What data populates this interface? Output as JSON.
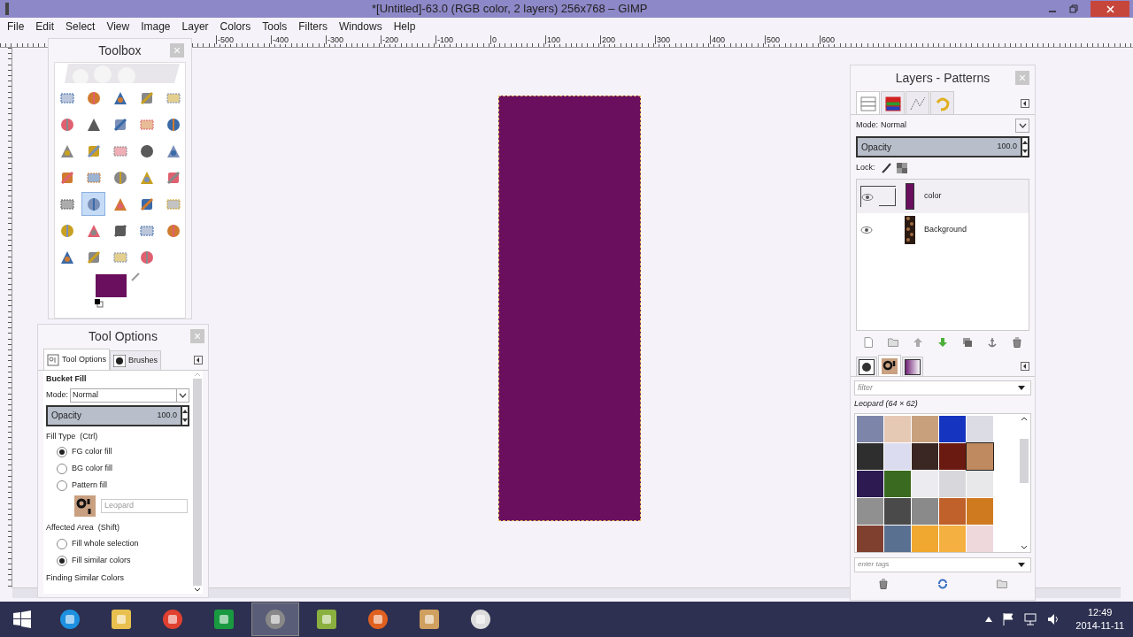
{
  "window": {
    "title": "*[Untitled]-63.0 (RGB color, 2 layers) 256x768 – GIMP"
  },
  "menu": [
    "File",
    "Edit",
    "Select",
    "View",
    "Image",
    "Layer",
    "Colors",
    "Tools",
    "Filters",
    "Windows",
    "Help"
  ],
  "ruler": {
    "labels": [
      "-500",
      "-400",
      "-300",
      "-200",
      "-100",
      "0",
      "100",
      "200",
      "300",
      "400",
      "500",
      "600"
    ]
  },
  "toolbox": {
    "title": "Toolbox",
    "tools": [
      {
        "selected": false
      },
      {
        "selected": false
      },
      {
        "selected": false
      },
      {
        "selected": false
      },
      {
        "selected": false
      },
      {
        "selected": false
      },
      {
        "selected": false
      },
      {
        "selected": false
      },
      {
        "selected": false
      },
      {
        "selected": false
      },
      {
        "selected": false
      },
      {
        "selected": false
      },
      {
        "selected": false
      },
      {
        "selected": false
      },
      {
        "selected": false
      },
      {
        "selected": false
      },
      {
        "selected": false
      },
      {
        "selected": false
      },
      {
        "selected": false
      },
      {
        "selected": false
      },
      {
        "selected": false
      },
      {
        "selected": true
      },
      {
        "selected": false
      },
      {
        "selected": false
      },
      {
        "selected": false
      },
      {
        "selected": false
      },
      {
        "selected": false
      },
      {
        "selected": false
      },
      {
        "selected": false
      },
      {
        "selected": false
      },
      {
        "selected": false
      },
      {
        "selected": false
      },
      {
        "selected": false
      },
      {
        "selected": false
      }
    ]
  },
  "tool_options": {
    "title": "Tool Options",
    "tabs": [
      {
        "label": "Tool Options",
        "selected": true
      },
      {
        "label": "Brushes",
        "selected": false
      }
    ],
    "tool_name": "Bucket Fill",
    "mode_label": "Mode:",
    "mode": "Normal",
    "opacity": {
      "label": "Opacity",
      "value": "100.0",
      "level": 1
    },
    "fill_type": {
      "label": "Fill Type  (Ctrl)",
      "options": [
        {
          "label": "FG color fill",
          "selected": true
        },
        {
          "label": "BG color fill",
          "selected": false
        },
        {
          "label": "Pattern fill",
          "selected": false
        }
      ]
    },
    "pattern_field": "Leopard",
    "affected_area": {
      "label": "Affected Area  (Shift)",
      "options": [
        {
          "label": "Fill whole selection",
          "selected": false
        },
        {
          "label": "Fill similar colors",
          "selected": true
        }
      ]
    },
    "finding_label": "Finding Similar Colors"
  },
  "layers_dock": {
    "title": "Layers - Patterns",
    "mode_label": "Mode:",
    "mode": "Normal",
    "opacity": {
      "label": "Opacity",
      "value": "100.0",
      "level": 1
    },
    "lock_label": "Lock:",
    "layers": [
      {
        "name": "color",
        "kind": "solid",
        "selected": true,
        "visible": true
      },
      {
        "name": "Background",
        "kind": "texture",
        "selected": false,
        "visible": true
      }
    ],
    "filter_placeholder": "filter",
    "pattern_name": "Leopard (64 × 62)",
    "tags_placeholder": "enter tags",
    "patterns": [
      {
        "color": "#7d86a8",
        "selected": false
      },
      {
        "color": "#e6c9b4",
        "selected": false
      },
      {
        "color": "#c9a07c",
        "selected": false
      },
      {
        "color": "#1535c0",
        "selected": false
      },
      {
        "color": "#dcdce4",
        "selected": false
      },
      {
        "color": "#2e2e2e",
        "selected": false
      },
      {
        "color": "#dcdcf0",
        "selected": false
      },
      {
        "color": "#3a2622",
        "selected": false
      },
      {
        "color": "#6a1a10",
        "selected": false
      },
      {
        "color": "#c08a60",
        "selected": true
      },
      {
        "color": "#2c1a50",
        "selected": false
      },
      {
        "color": "#3a6a20",
        "selected": false
      },
      {
        "color": "#ececf0",
        "selected": false
      },
      {
        "color": "#d8d8dc",
        "selected": false
      },
      {
        "color": "#e8e8ea",
        "selected": false
      },
      {
        "color": "#909090",
        "selected": false
      },
      {
        "color": "#4a4a4a",
        "selected": false
      },
      {
        "color": "#8a8a8a",
        "selected": false
      },
      {
        "color": "#c0602a",
        "selected": false
      },
      {
        "color": "#d07a20",
        "selected": false
      },
      {
        "color": "#804030",
        "selected": false
      },
      {
        "color": "#5a7090",
        "selected": false
      },
      {
        "color": "#f0a830",
        "selected": false
      },
      {
        "color": "#f4b040",
        "selected": false
      },
      {
        "color": "#eed8dc",
        "selected": false
      }
    ]
  },
  "taskbar": {
    "apps": [
      {
        "selected": false
      },
      {
        "selected": false
      },
      {
        "selected": false
      },
      {
        "selected": false
      },
      {
        "selected": true
      },
      {
        "selected": false
      },
      {
        "selected": false
      },
      {
        "selected": false
      },
      {
        "selected": false
      }
    ],
    "time": "12:49",
    "date": "2014-11-11"
  }
}
